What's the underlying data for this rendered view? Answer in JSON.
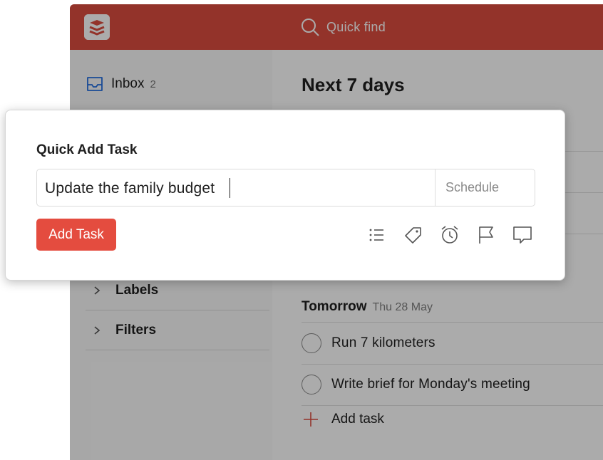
{
  "topbar": {
    "search_label": "Quick find",
    "color": "#db4c3f"
  },
  "sidebar": {
    "inbox": {
      "label": "Inbox",
      "count": "2"
    },
    "sections": [
      {
        "label": "Labels"
      },
      {
        "label": "Filters"
      }
    ]
  },
  "main": {
    "title": "Next 7 days",
    "day": {
      "label": "Tomorrow",
      "date": "Thu 28 May"
    },
    "tasks": [
      {
        "text": "Run 7 kilometers"
      },
      {
        "text": "Write brief for Monday's meeting"
      }
    ],
    "add_task_label": "Add task"
  },
  "modal": {
    "title": "Quick Add Task",
    "input_value": "Update the family budget",
    "schedule_label": "Schedule",
    "add_button": "Add Task",
    "tools": [
      "project-list-icon",
      "label-tag-icon",
      "reminder-alarm-icon",
      "priority-flag-icon",
      "comment-icon"
    ]
  }
}
